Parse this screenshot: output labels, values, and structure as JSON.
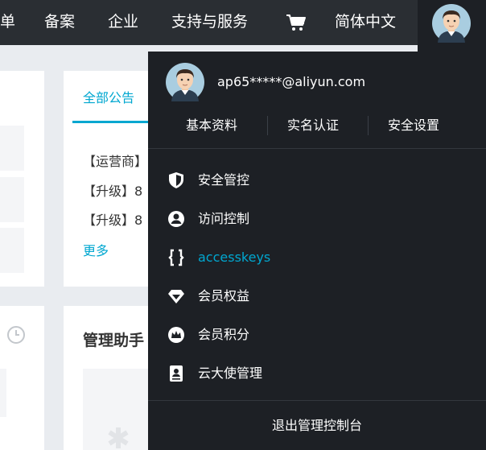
{
  "topnav": {
    "items": [
      "单",
      "备案",
      "企业",
      "支持与服务"
    ],
    "language": "简体中文",
    "icons": {
      "cart": "cart-icon",
      "avatar": "avatar-icon"
    }
  },
  "background": {
    "announcements": {
      "tab_label": "全部公告",
      "items": [
        "【运营商】",
        "【升级】8",
        "【升级】8"
      ],
      "more_label": "更多"
    },
    "helper_title": "管理助手"
  },
  "account_menu": {
    "email": "ap65*****@aliyun.com",
    "links": [
      "基本资料",
      "实名认证",
      "安全设置"
    ],
    "items": [
      {
        "label": "安全管控",
        "icon": "shield-icon"
      },
      {
        "label": "访问控制",
        "icon": "user-circle-icon"
      },
      {
        "label": "accesskeys",
        "icon": "braces-icon",
        "active": true
      },
      {
        "label": "会员权益",
        "icon": "diamond-icon"
      },
      {
        "label": "会员积分",
        "icon": "crown-icon"
      },
      {
        "label": "云大使管理",
        "icon": "id-card-icon"
      }
    ],
    "logout_label": "退出管理控制台"
  },
  "colors": {
    "accent": "#00a7d0",
    "topbar": "#2a2e33",
    "dropdown": "#1d2025"
  }
}
